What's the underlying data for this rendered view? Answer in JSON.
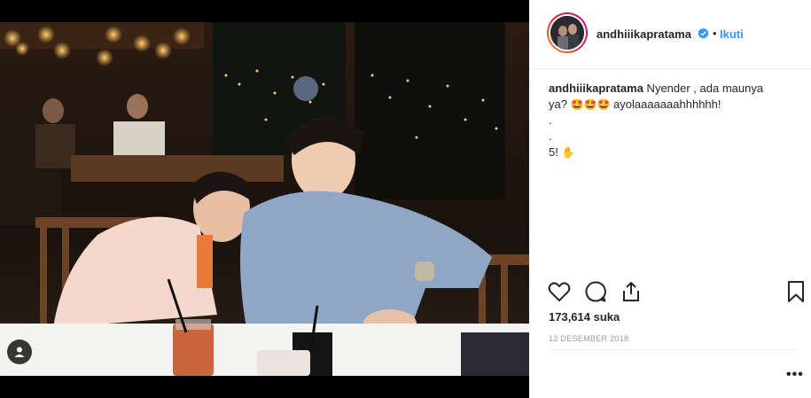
{
  "post": {
    "username": "andhiiikapratama",
    "follow_label": "Ikuti",
    "separator": "•",
    "caption": {
      "username": "andhiiikapratama",
      "text_line1": " Nyender , ada maunya",
      "text_line2_prefix": "ya? ",
      "emoji_1": "🤩",
      "emoji_2": "🤩",
      "emoji_3": "🤩",
      "text_line2_suffix": " ayolaaaaaaahhhhhh!",
      "line3": ".",
      "line4": ".",
      "line5_text": "5! ",
      "line5_emoji": "✋"
    },
    "likes": "173,614 suka",
    "date": "12 DESEMBER 2018",
    "more_label": "•••"
  },
  "icons": {
    "like": "heart-icon",
    "comment": "comment-icon",
    "share": "share-icon",
    "save": "bookmark-icon",
    "verified": "verified-badge-icon",
    "user_tag": "user-tag-icon"
  },
  "colors": {
    "accent": "#3897f0",
    "text": "#262626",
    "muted": "#999999",
    "divider": "#efefef"
  }
}
